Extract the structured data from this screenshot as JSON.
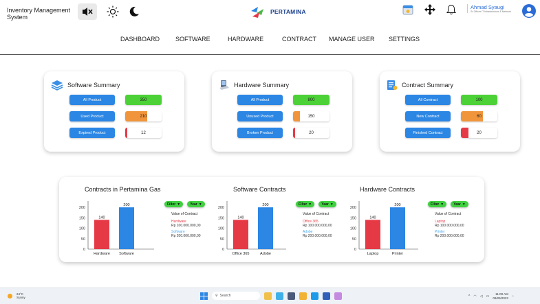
{
  "app": {
    "title": "Inventory Management System",
    "brand": "PERTAMINA"
  },
  "header_icons": [
    "mute-icon",
    "sun-icon",
    "moon-icon",
    "calendar-icon",
    "move-icon",
    "bell-icon",
    "user-avatar-icon"
  ],
  "user": {
    "name": "Ahmad Syaugi",
    "role": "Sr Officer IT Infrastructure & Network"
  },
  "nav": [
    "DASHBOARD",
    "SOFTWARE",
    "HARDWARE",
    "CONTRACT",
    "MANAGE USER",
    "SETTINGS"
  ],
  "summaries": [
    {
      "title": "Software Summary",
      "icon": "layers-icon",
      "rows": [
        {
          "label": "All Product",
          "value": "350",
          "color": "#4cd137",
          "fill": 1.0
        },
        {
          "label": "Used Product",
          "value": "210",
          "color": "#f0953b",
          "fill": 0.6
        },
        {
          "label": "Expired Product",
          "value": "12",
          "color": "#e63946",
          "fill": 0.05
        }
      ]
    },
    {
      "title": "Hardware Summary",
      "icon": "computer-icon",
      "rows": [
        {
          "label": "All Product",
          "value": "800",
          "color": "#4cd137",
          "fill": 1.0
        },
        {
          "label": "Unused Product",
          "value": "150",
          "color": "#f0953b",
          "fill": 0.19
        },
        {
          "label": "Broken Product",
          "value": "20",
          "color": "#e63946",
          "fill": 0.05
        }
      ]
    },
    {
      "title": "Contract Summary",
      "icon": "contract-icon",
      "rows": [
        {
          "label": "All Contract",
          "value": "100",
          "color": "#4cd137",
          "fill": 1.0
        },
        {
          "label": "New Contract",
          "value": "60",
          "color": "#f0953b",
          "fill": 0.6
        },
        {
          "label": "Finished Contract",
          "value": "20",
          "color": "#e63946",
          "fill": 0.2
        }
      ]
    }
  ],
  "charts": {
    "filter_label": "Filter",
    "year_label": "Year",
    "value_title": "Value of Contract"
  },
  "chart_data": [
    {
      "type": "bar",
      "title": "Contracts in Pertamina Gas",
      "categories": [
        "Hardware",
        "Software"
      ],
      "values": [
        140,
        200
      ],
      "colors": [
        "#e63946",
        "#2b86e4"
      ],
      "yticks": [
        0,
        50,
        100,
        150,
        200
      ],
      "ylim": [
        0,
        230
      ],
      "legend": [
        {
          "name": "Hardware",
          "value": "Rp 100.000.000,00"
        },
        {
          "name": "Software",
          "value": "Rp 200.000.000,00"
        }
      ]
    },
    {
      "type": "bar",
      "title": "Software Contracts",
      "categories": [
        "Office 365",
        "Adobe"
      ],
      "values": [
        140,
        200
      ],
      "colors": [
        "#e63946",
        "#2b86e4"
      ],
      "yticks": [
        0,
        50,
        100,
        150,
        200
      ],
      "ylim": [
        0,
        230
      ],
      "legend": [
        {
          "name": "Office 365",
          "value": "Rp 100.000.000,00"
        },
        {
          "name": "Adobe",
          "value": "Rp 200.000.000,00"
        }
      ]
    },
    {
      "type": "bar",
      "title": "Hardware Contracts",
      "categories": [
        "Laptop",
        "Printer"
      ],
      "values": [
        140,
        200
      ],
      "colors": [
        "#e63946",
        "#2b86e4"
      ],
      "yticks": [
        0,
        50,
        100,
        150,
        200
      ],
      "ylim": [
        0,
        230
      ],
      "legend": [
        {
          "name": "Laptop",
          "value": "Rp 100.000.000,00"
        },
        {
          "name": "Printer",
          "value": "Rp 200.000.000,00"
        }
      ]
    }
  ],
  "taskbar": {
    "weather_temp": "24°C",
    "weather_desc": "Sunny",
    "search_placeholder": "Search",
    "time": "11:00 AM",
    "date": "09/26/2023"
  }
}
